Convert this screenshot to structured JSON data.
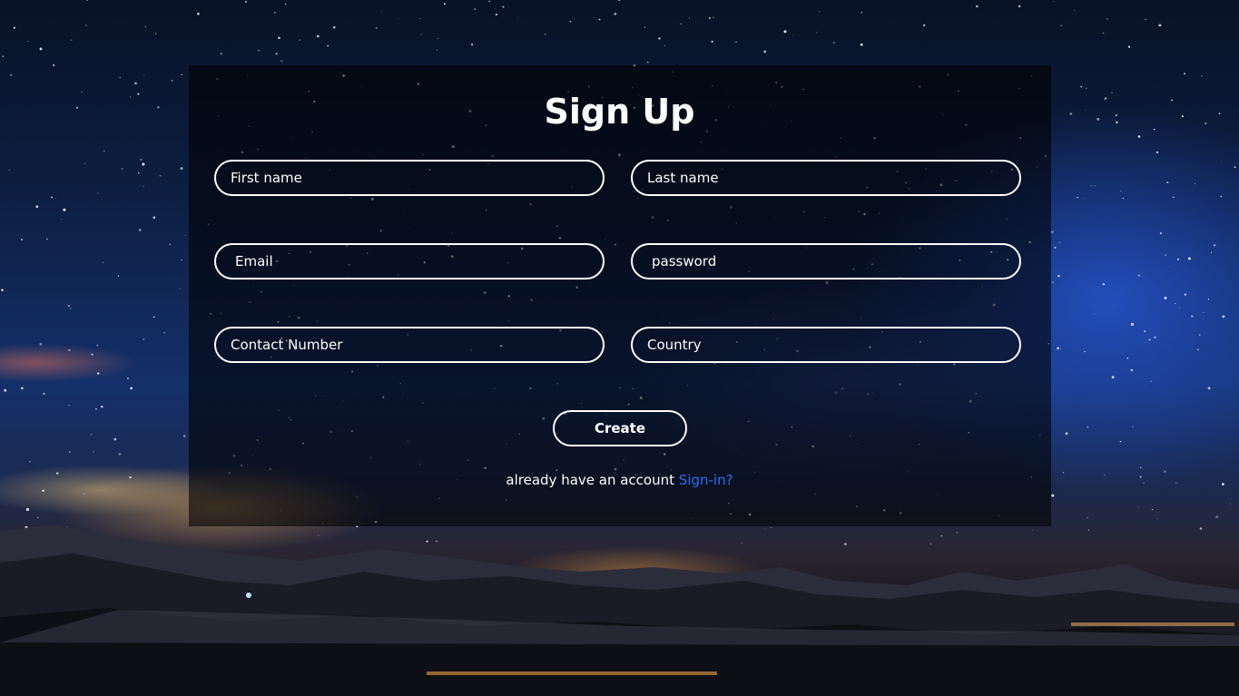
{
  "form": {
    "title": "Sign Up",
    "fields": {
      "first_name": {
        "placeholder": "First name",
        "value": ""
      },
      "last_name": {
        "placeholder": "Last name",
        "value": ""
      },
      "email": {
        "placeholder": "Email",
        "value": ""
      },
      "password": {
        "placeholder": "password",
        "value": ""
      },
      "contact": {
        "placeholder": "Contact Number",
        "value": ""
      },
      "country": {
        "placeholder": "Country",
        "value": ""
      }
    },
    "create_label": "Create",
    "account_prompt": "already have an account",
    "signin_label": "Sign-in?"
  },
  "colors": {
    "link": "#2f6cf2",
    "field_border": "#ffffff",
    "panel_overlay": "rgba(0,0,0,0.58)"
  }
}
